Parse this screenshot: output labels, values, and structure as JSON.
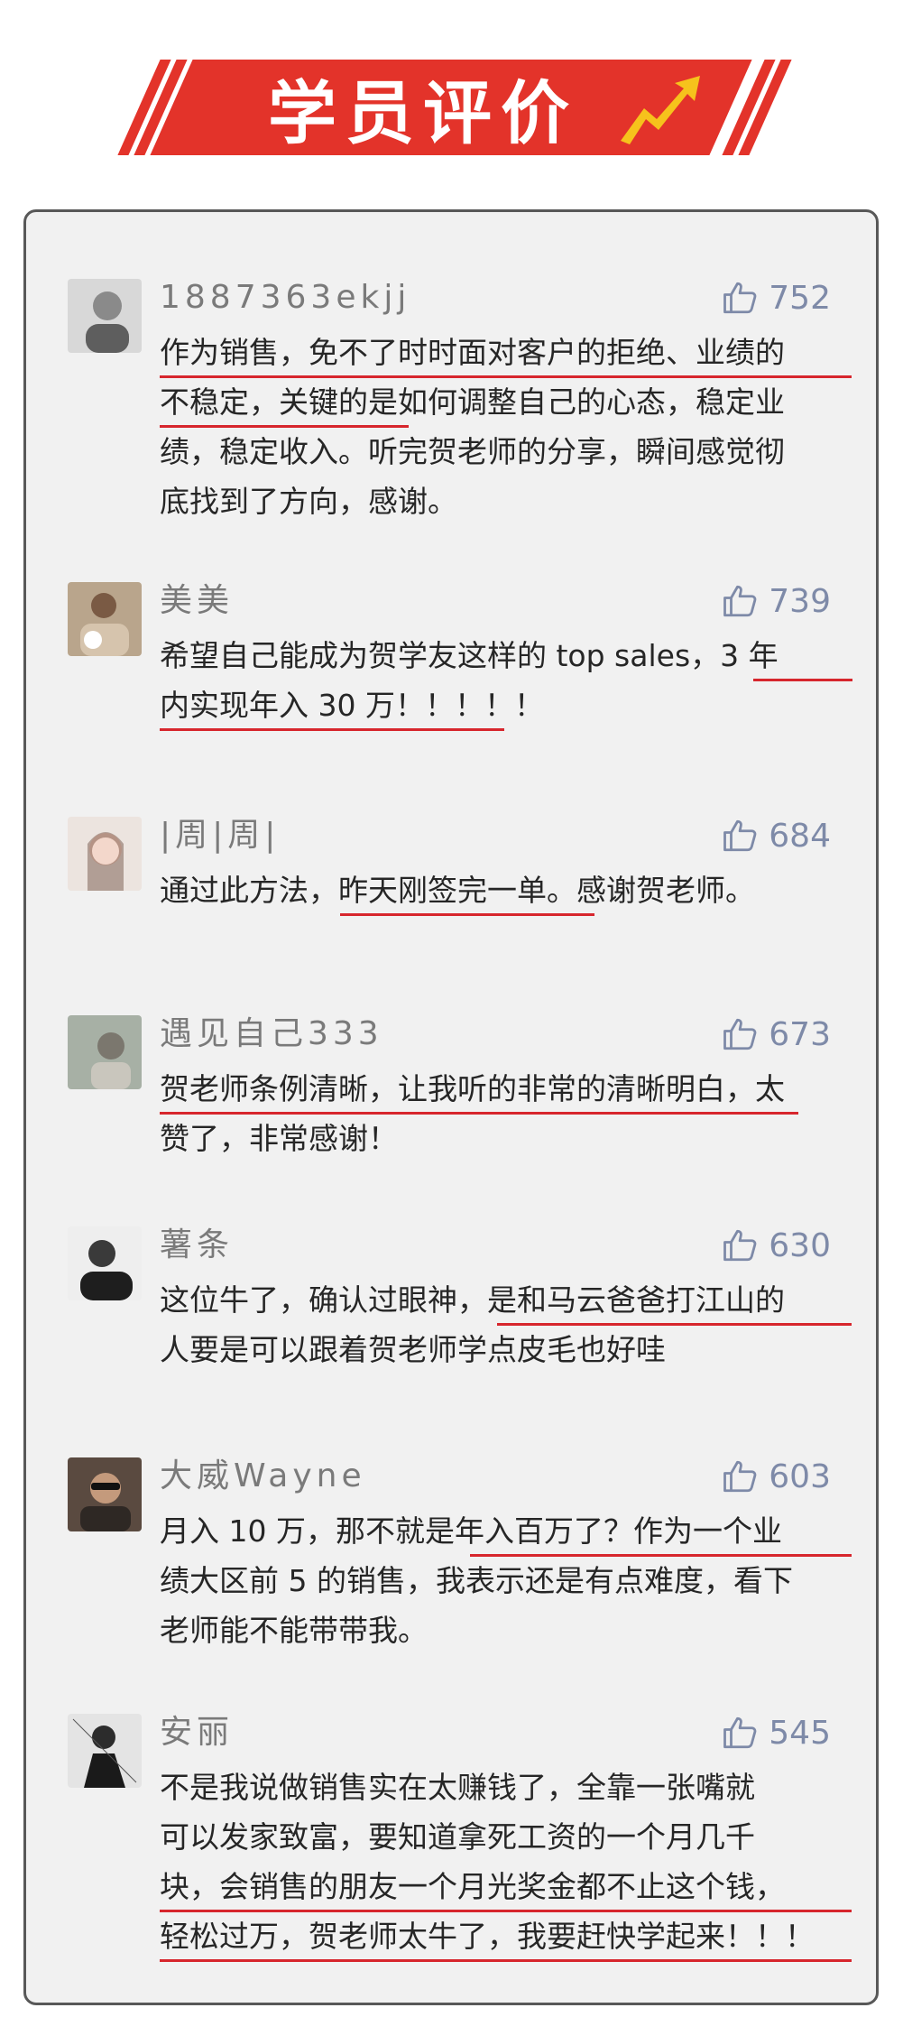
{
  "banner": {
    "title": "学员评价"
  },
  "colors": {
    "banner_red": "#e3332a",
    "underline_red": "#d7262d",
    "like_blue": "#7e8aa8",
    "card_bg": "#f1f1f1"
  },
  "reviews": [
    {
      "name": "1887363ekjj",
      "likes": "752",
      "text": "作为销售，免不了时时面对客户的拒绝、业绩的\n不稳定，关键的是如何调整自己的心态，稳定业\n绩，稳定收入。听完贺老师的分享，瞬间感觉彻\n底找到了方向，感谢。"
    },
    {
      "name": "美美",
      "likes": "739",
      "text": "希望自己能成为贺学友这样的 top sales，3 年\n内实现年入 30 万！！！！！"
    },
    {
      "name": "|周|周|",
      "likes": "684",
      "text": "通过此方法，昨天刚签完一单。感谢贺老师。"
    },
    {
      "name": "遇见自己333",
      "likes": "673",
      "text": "贺老师条例清晰，让我听的非常的清晰明白，太\n赞了，非常感谢！"
    },
    {
      "name": "薯条",
      "likes": "630",
      "text": "这位牛了，确认过眼神，是和马云爸爸打江山的\n人要是可以跟着贺老师学点皮毛也好哇"
    },
    {
      "name": "大威Wayne",
      "likes": "603",
      "text": "月入 10 万，那不就是年入百万了？作为一个业\n绩大区前 5 的销售，我表示还是有点难度，看下\n老师能不能带带我。"
    },
    {
      "name": "安丽",
      "likes": "545",
      "text": "不是我说做销售实在太赚钱了，全靠一张嘴就\n可以发家致富，要知道拿死工资的一个月几千\n块，会销售的朋友一个月光奖金都不止这个钱，\n轻松过万，贺老师太牛了，我要赶快学起来！！！"
    }
  ]
}
